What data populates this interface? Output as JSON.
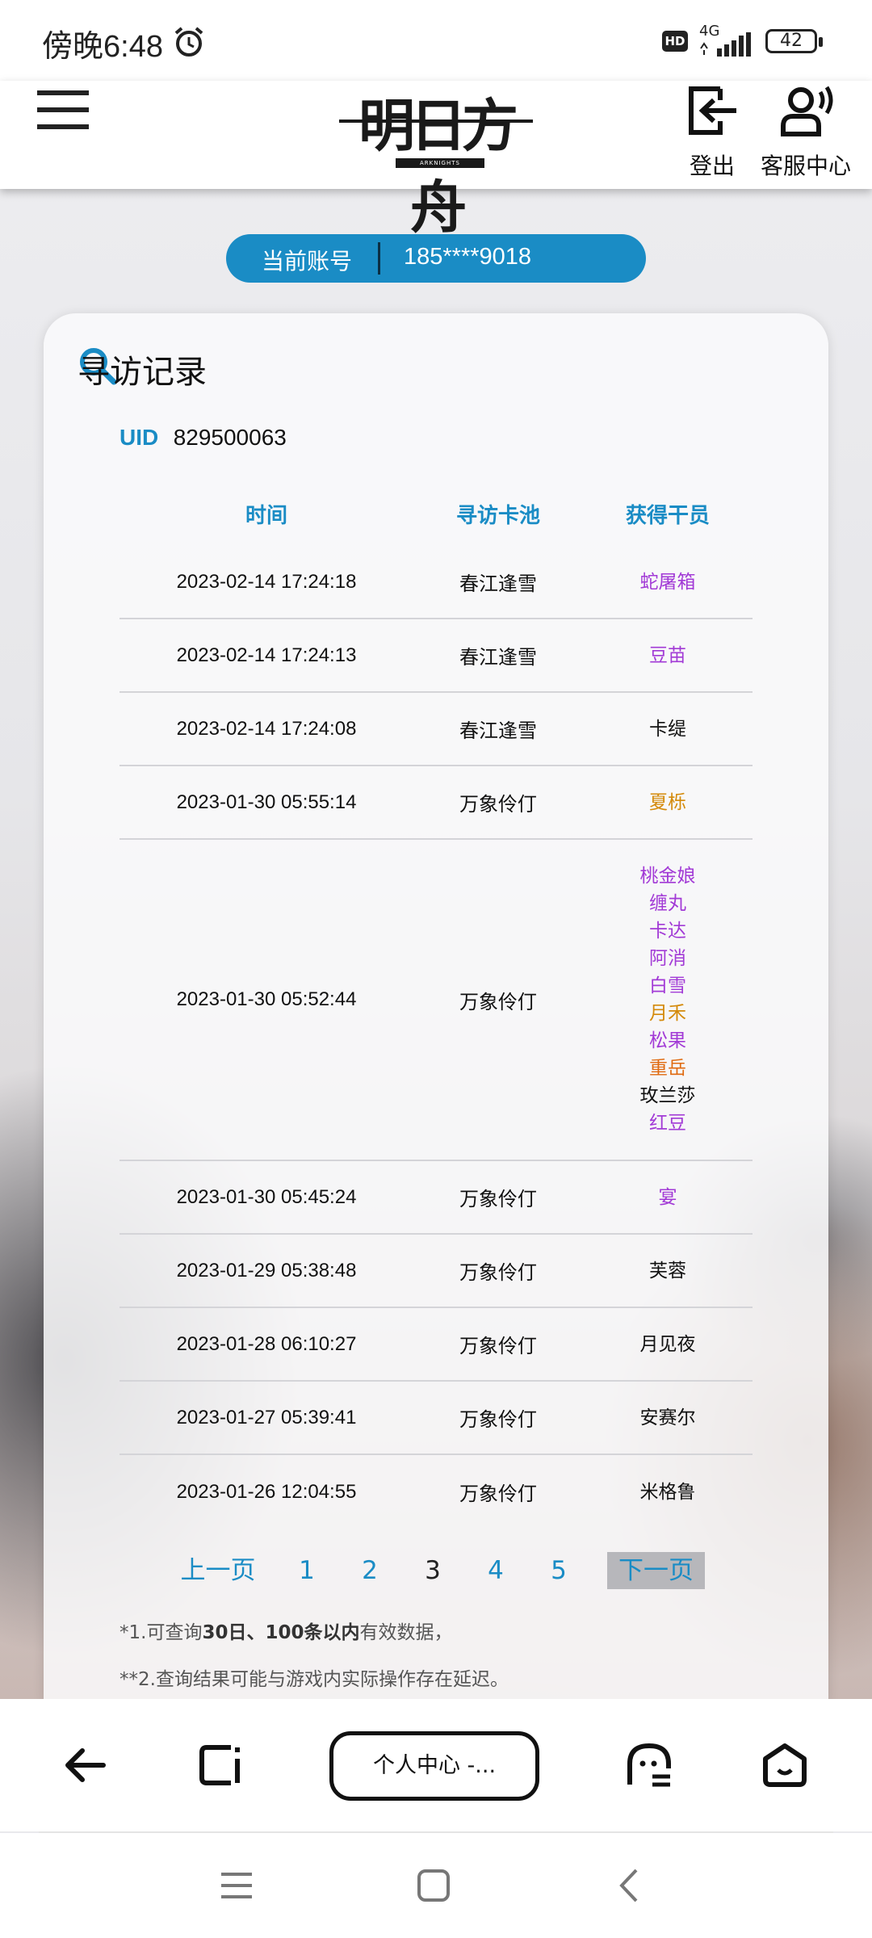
{
  "status_bar": {
    "time": "傍晚6:48",
    "hd": "HD",
    "network": "4G",
    "battery": "42"
  },
  "header": {
    "logo_text": "明日方舟",
    "logo_sub": "ARKNIGHTS",
    "logout_label": "登出",
    "service_label": "客服中心"
  },
  "account": {
    "label": "当前账号",
    "value": "185****9018"
  },
  "record": {
    "title": "寻访记录",
    "uid_label": "UID",
    "uid_value": "829500063",
    "columns": [
      "时间",
      "寻访卡池",
      "获得干员"
    ],
    "rows": [
      {
        "time": "2023-02-14 17:24:18",
        "pool": "春江逢雪",
        "operators": [
          {
            "name": "蛇屠箱",
            "color": "#a23ad6"
          }
        ]
      },
      {
        "time": "2023-02-14 17:24:13",
        "pool": "春江逢雪",
        "operators": [
          {
            "name": "豆苗",
            "color": "#a23ad6"
          }
        ]
      },
      {
        "time": "2023-02-14 17:24:08",
        "pool": "春江逢雪",
        "operators": [
          {
            "name": "卡缇",
            "color": "#111111"
          }
        ]
      },
      {
        "time": "2023-01-30 05:55:14",
        "pool": "万象伶仃",
        "operators": [
          {
            "name": "夏栎",
            "color": "#d48a0a"
          }
        ]
      },
      {
        "time": "2023-01-30 05:52:44",
        "pool": "万象伶仃",
        "operators": [
          {
            "name": "桃金娘",
            "color": "#a23ad6"
          },
          {
            "name": "缠丸",
            "color": "#a23ad6"
          },
          {
            "name": "卡达",
            "color": "#a23ad6"
          },
          {
            "name": "阿消",
            "color": "#a23ad6"
          },
          {
            "name": "白雪",
            "color": "#a23ad6"
          },
          {
            "name": "月禾",
            "color": "#d48a0a"
          },
          {
            "name": "松果",
            "color": "#a23ad6"
          },
          {
            "name": "重岳",
            "color": "#e06a10"
          },
          {
            "name": "玫兰莎",
            "color": "#111111"
          },
          {
            "name": "红豆",
            "color": "#a23ad6"
          }
        ]
      },
      {
        "time": "2023-01-30 05:45:24",
        "pool": "万象伶仃",
        "operators": [
          {
            "name": "宴",
            "color": "#a23ad6"
          }
        ]
      },
      {
        "time": "2023-01-29 05:38:48",
        "pool": "万象伶仃",
        "operators": [
          {
            "name": "芙蓉",
            "color": "#111111"
          }
        ]
      },
      {
        "time": "2023-01-28 06:10:27",
        "pool": "万象伶仃",
        "operators": [
          {
            "name": "月见夜",
            "color": "#111111"
          }
        ]
      },
      {
        "time": "2023-01-27 05:39:41",
        "pool": "万象伶仃",
        "operators": [
          {
            "name": "安赛尔",
            "color": "#111111"
          }
        ]
      },
      {
        "time": "2023-01-26 12:04:55",
        "pool": "万象伶仃",
        "operators": [
          {
            "name": "米格鲁",
            "color": "#111111"
          }
        ]
      }
    ]
  },
  "pagination": {
    "prev": "上一页",
    "pages": [
      "1",
      "2",
      "3",
      "4",
      "5"
    ],
    "current": "3",
    "next": "下一页"
  },
  "notes": {
    "note1_prefix": "*1.可查询",
    "note1_bold1": "30日、100条以内",
    "note1_suffix": "有效数据，",
    "note2": "**2.查询结果可能与游戏内实际操作存在延迟。"
  },
  "browser": {
    "tab_label": "个人中心 -..."
  },
  "colors": {
    "accent": "#1a8cc5",
    "rarity_4": "#a23ad6",
    "rarity_5": "#d48a0a",
    "rarity_6": "#e06a10"
  }
}
